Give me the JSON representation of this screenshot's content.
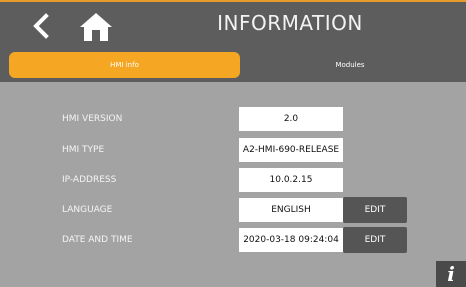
{
  "header": {
    "title": "INFORMATION"
  },
  "nav": {
    "back_icon": "chevron-left-icon",
    "home_icon": "home-icon"
  },
  "tabs": [
    {
      "label": "HMI info",
      "active": true
    },
    {
      "label": "Modules",
      "active": false
    }
  ],
  "info": {
    "rows": [
      {
        "label": "HMI VERSION",
        "value": "2.0"
      },
      {
        "label": "HMI TYPE",
        "value": "A2-HMI-690-RELEASE"
      },
      {
        "label": "IP-ADDRESS",
        "value": "10.0.2.15"
      },
      {
        "label": "LANGUAGE",
        "value": "ENGLISH",
        "edit_label": "EDIT"
      },
      {
        "label": "DATE AND TIME",
        "value": "2020-03-18 09:24:04",
        "edit_label": "EDIT"
      }
    ]
  },
  "footer": {
    "info_icon_glyph": "i"
  },
  "colors": {
    "accent": "#f5a623",
    "header_bg": "#5d5d5d",
    "body_bg": "#a3a3a3"
  }
}
